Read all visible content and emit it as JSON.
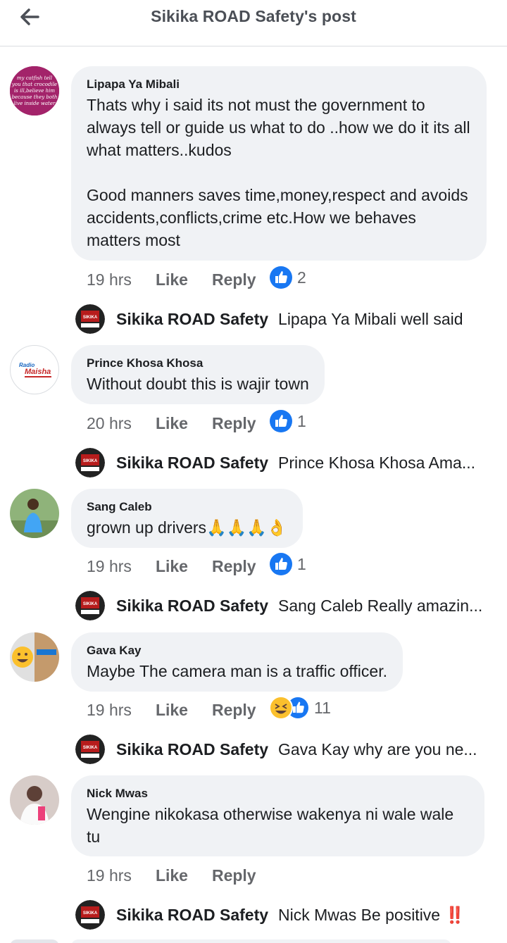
{
  "header": {
    "title": "Sikika ROAD Safety's post"
  },
  "reply_author": "Sikika ROAD Safety",
  "comments": [
    {
      "name": "Lipapa Ya Mibali",
      "text": "Thats why i said its not must the government to always tell or guide us what to do ..how we do it its all what matters..kudos\n\nGood manners saves time,money,respect and avoids accidents,conflicts,crime etc.How we behaves matters most",
      "time": "19 hrs",
      "like": "Like",
      "reply": "Reply",
      "reaction_count": "2",
      "reply_text": "Lipapa Ya Mibali well said"
    },
    {
      "name": "Prince Khosa Khosa",
      "text": "Without doubt this is wajir town",
      "time": "20 hrs",
      "like": "Like",
      "reply": "Reply",
      "reaction_count": "1",
      "reply_text": "Prince Khosa Khosa Ama..."
    },
    {
      "name": "Sang Caleb",
      "text": "grown up drivers🙏🙏🙏👌",
      "time": "19 hrs",
      "like": "Like",
      "reply": "Reply",
      "reaction_count": "1",
      "reply_text": "Sang Caleb Really amazin..."
    },
    {
      "name": "Gava Kay",
      "text": "Maybe The camera man is a traffic officer.",
      "time": "19 hrs",
      "like": "Like",
      "reply": "Reply",
      "reaction_count": "11",
      "reply_text": "Gava Kay why are you ne..."
    },
    {
      "name": "Nick Mwas",
      "text": "Wengine nikokasa otherwise wakenya ni wale wale tu",
      "time": "19 hrs",
      "like": "Like",
      "reply": "Reply",
      "reply_text": "Nick Mwas Be positive ‼️"
    }
  ],
  "avatar_texts": {
    "lipapa": "my catfish tell you that crocodile is ill, believe him because they both live inside water",
    "radio": "Radio Maisha",
    "sikika": "SIKIKA"
  },
  "colors": {
    "like_blue": "#1877f2",
    "bubble": "#f0f2f5",
    "meta_gray": "#65676b"
  }
}
